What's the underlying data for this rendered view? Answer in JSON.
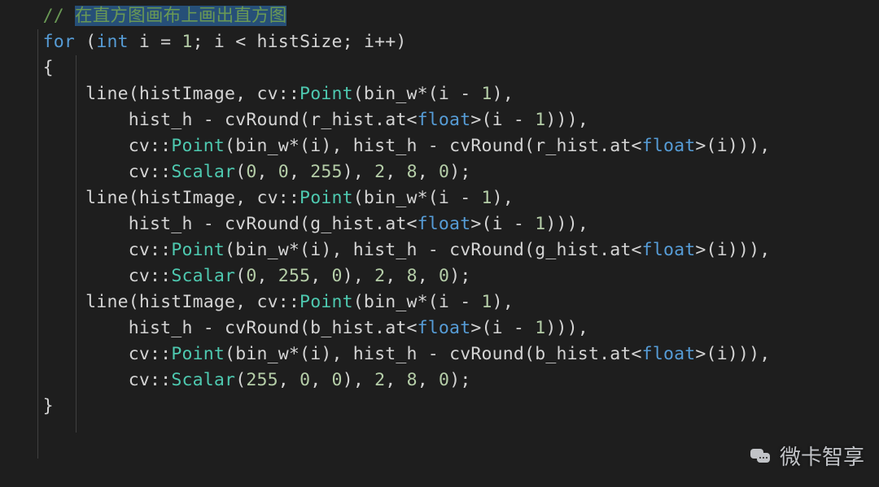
{
  "code": {
    "comment_prefix": "// ",
    "comment_text": "在直方图画布上画出直方图",
    "lines": [
      {
        "indent": 1,
        "tokens": [
          [
            "keyword",
            "for"
          ],
          [
            "default",
            " ("
          ],
          [
            "type",
            "int"
          ],
          [
            "default",
            " i = "
          ],
          [
            "number",
            "1"
          ],
          [
            "default",
            "; i < histSize; i++)"
          ]
        ]
      },
      {
        "indent": 1,
        "tokens": [
          [
            "default",
            "{"
          ]
        ]
      },
      {
        "indent": 2,
        "tokens": [
          [
            "default",
            "line(histImage, cv::"
          ],
          [
            "class",
            "Point"
          ],
          [
            "default",
            "(bin_w*(i - "
          ],
          [
            "number",
            "1"
          ],
          [
            "default",
            "),"
          ]
        ]
      },
      {
        "indent": 3,
        "tokens": [
          [
            "default",
            "hist_h - cvRound(r_hist.at<"
          ],
          [
            "type",
            "float"
          ],
          [
            "default",
            ">(i - "
          ],
          [
            "number",
            "1"
          ],
          [
            "default",
            "))),"
          ]
        ]
      },
      {
        "indent": 3,
        "tokens": [
          [
            "default",
            "cv::"
          ],
          [
            "class",
            "Point"
          ],
          [
            "default",
            "(bin_w*(i), hist_h - cvRound(r_hist.at<"
          ],
          [
            "type",
            "float"
          ],
          [
            "default",
            ">(i))),"
          ]
        ]
      },
      {
        "indent": 3,
        "tokens": [
          [
            "default",
            "cv::"
          ],
          [
            "class",
            "Scalar"
          ],
          [
            "default",
            "("
          ],
          [
            "number",
            "0"
          ],
          [
            "default",
            ", "
          ],
          [
            "number",
            "0"
          ],
          [
            "default",
            ", "
          ],
          [
            "number",
            "255"
          ],
          [
            "default",
            "), "
          ],
          [
            "number",
            "2"
          ],
          [
            "default",
            ", "
          ],
          [
            "number",
            "8"
          ],
          [
            "default",
            ", "
          ],
          [
            "number",
            "0"
          ],
          [
            "default",
            ");"
          ]
        ]
      },
      {
        "indent": 2,
        "tokens": [
          [
            "default",
            "line(histImage, cv::"
          ],
          [
            "class",
            "Point"
          ],
          [
            "default",
            "(bin_w*(i - "
          ],
          [
            "number",
            "1"
          ],
          [
            "default",
            "),"
          ]
        ]
      },
      {
        "indent": 3,
        "tokens": [
          [
            "default",
            "hist_h - cvRound(g_hist.at<"
          ],
          [
            "type",
            "float"
          ],
          [
            "default",
            ">(i - "
          ],
          [
            "number",
            "1"
          ],
          [
            "default",
            "))),"
          ]
        ]
      },
      {
        "indent": 3,
        "tokens": [
          [
            "default",
            "cv::"
          ],
          [
            "class",
            "Point"
          ],
          [
            "default",
            "(bin_w*(i), hist_h - cvRound(g_hist.at<"
          ],
          [
            "type",
            "float"
          ],
          [
            "default",
            ">(i))),"
          ]
        ]
      },
      {
        "indent": 3,
        "tokens": [
          [
            "default",
            "cv::"
          ],
          [
            "class",
            "Scalar"
          ],
          [
            "default",
            "("
          ],
          [
            "number",
            "0"
          ],
          [
            "default",
            ", "
          ],
          [
            "number",
            "255"
          ],
          [
            "default",
            ", "
          ],
          [
            "number",
            "0"
          ],
          [
            "default",
            "), "
          ],
          [
            "number",
            "2"
          ],
          [
            "default",
            ", "
          ],
          [
            "number",
            "8"
          ],
          [
            "default",
            ", "
          ],
          [
            "number",
            "0"
          ],
          [
            "default",
            ");"
          ]
        ]
      },
      {
        "indent": 2,
        "tokens": [
          [
            "default",
            "line(histImage, cv::"
          ],
          [
            "class",
            "Point"
          ],
          [
            "default",
            "(bin_w*(i - "
          ],
          [
            "number",
            "1"
          ],
          [
            "default",
            "),"
          ]
        ]
      },
      {
        "indent": 3,
        "tokens": [
          [
            "default",
            "hist_h - cvRound(b_hist.at<"
          ],
          [
            "type",
            "float"
          ],
          [
            "default",
            ">(i - "
          ],
          [
            "number",
            "1"
          ],
          [
            "default",
            "))),"
          ]
        ]
      },
      {
        "indent": 3,
        "tokens": [
          [
            "default",
            "cv::"
          ],
          [
            "class",
            "Point"
          ],
          [
            "default",
            "(bin_w*(i), hist_h - cvRound(b_hist.at<"
          ],
          [
            "type",
            "float"
          ],
          [
            "default",
            ">(i))),"
          ]
        ]
      },
      {
        "indent": 3,
        "tokens": [
          [
            "default",
            "cv::"
          ],
          [
            "class",
            "Scalar"
          ],
          [
            "default",
            "("
          ],
          [
            "number",
            "255"
          ],
          [
            "default",
            ", "
          ],
          [
            "number",
            "0"
          ],
          [
            "default",
            ", "
          ],
          [
            "number",
            "0"
          ],
          [
            "default",
            "), "
          ],
          [
            "number",
            "2"
          ],
          [
            "default",
            ", "
          ],
          [
            "number",
            "8"
          ],
          [
            "default",
            ", "
          ],
          [
            "number",
            "0"
          ],
          [
            "default",
            ");"
          ]
        ]
      },
      {
        "indent": 1,
        "tokens": [
          [
            "default",
            "}"
          ]
        ]
      }
    ]
  },
  "watermark": {
    "text": "微卡智享"
  },
  "layout": {
    "indent_unit": "    "
  }
}
